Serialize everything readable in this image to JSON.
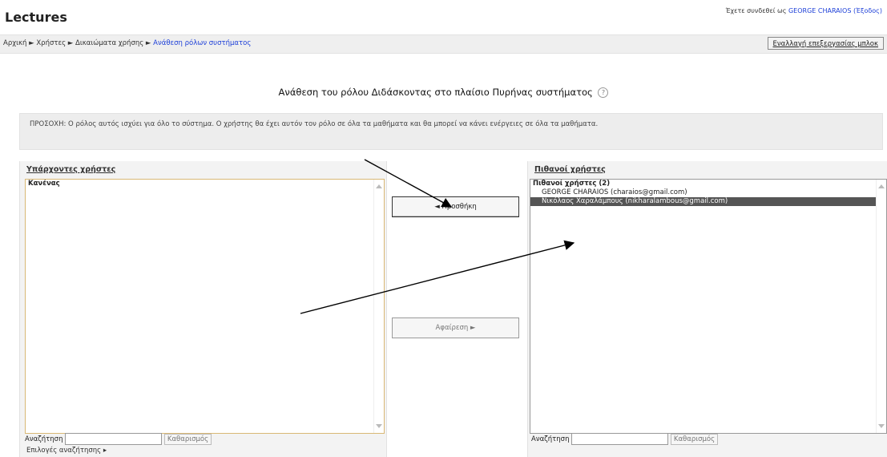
{
  "header": {
    "title": "Lectures",
    "login_prefix": "Έχετε συνδεθεί ως",
    "login_user": "GEORGE CHARAIOS",
    "login_suffix": "(Έξοδος)"
  },
  "breadcrumb": {
    "items": [
      "Αρχική",
      "Χρήστες",
      "Δικαιώματα χρήσης"
    ],
    "current": "Ανάθεση ρόλων συστήματος",
    "separator": "►"
  },
  "switch_button_label": "Εναλλαγή επεξεργασίας μπλοκ",
  "page_heading": "Ανάθεση του ρόλου Διδάσκοντας στο πλαίσιο Πυρήνας συστήματος",
  "help_icon": "?",
  "description": "ΠΡΟΣΟΧΗ: Ο ρόλος αυτός ισχύει για όλο το σύστημα. Ο χρήστης θα έχει αυτόν τον ρόλο σε όλα τα μαθήματα και θα μπορεί να κάνει ενέργειες σε όλα τα μαθήματα.",
  "existing": {
    "label": "Υπάρχοντες χρήστες",
    "items": [
      "Κανένας"
    ],
    "search_label": "Αναζήτηση",
    "search_value": "",
    "clear_label": "Καθαρισμός",
    "options_label": "Επιλογές αναζήτησης"
  },
  "potential": {
    "label": "Πιθανοί χρήστες",
    "group": "Πιθανοί χρήστες (2)",
    "items": [
      "GEORGE CHARAIOS (charaios@gmail.com)",
      "Νικόλαος Χαραλάμπους (nikharalambous@gmail.com)"
    ],
    "selected_index": 1,
    "search_label": "Αναζήτηση",
    "search_value": "",
    "clear_label": "Καθαρισμός"
  },
  "buttons": {
    "add": "◄ Προσθήκη",
    "remove": "Αφαίρεση ►"
  },
  "colors": {
    "link": "#1e40d8",
    "selected_row": "#555555",
    "panel_bg": "#f3f3f3",
    "arrow": "#000000"
  }
}
